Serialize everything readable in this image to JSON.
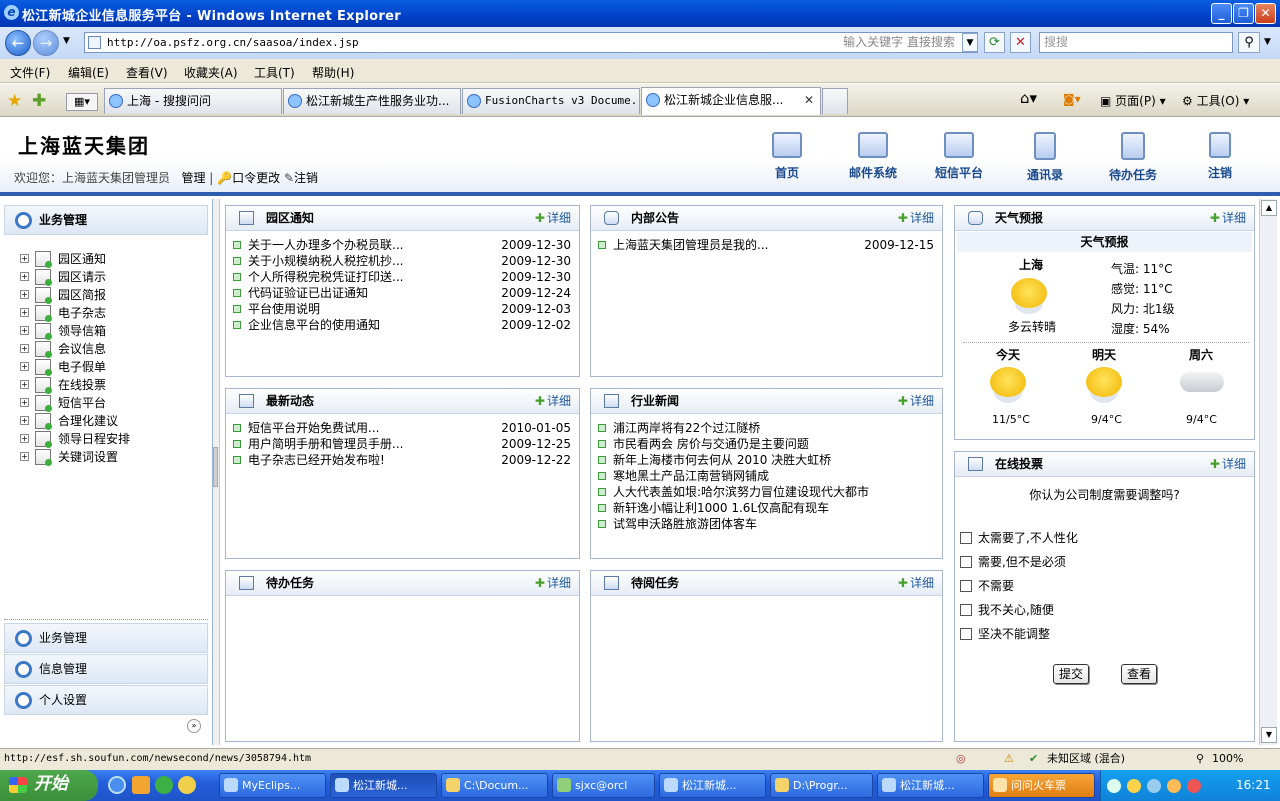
{
  "window": {
    "title": "松江新城企业信息服务平台 - Windows Internet Explorer"
  },
  "browser": {
    "address": "http://oa.psfz.org.cn/saasoa/index.jsp",
    "address_hint": "输入关键字 直接搜索",
    "search_placeholder": "搜搜",
    "menu": [
      "文件(F)",
      "编辑(E)",
      "查看(V)",
      "收藏夹(A)",
      "工具(T)",
      "帮助(H)"
    ],
    "tabs": [
      "上海 - 搜搜问问",
      "松江新城生产性服务业功...",
      "FusionCharts v3 Docume...",
      "松江新城企业信息服..."
    ],
    "page_menu": "页面(P)",
    "tools_menu": "工具(O)",
    "status_url": "http://esf.sh.soufun.com/newsecond/news/3058794.htm",
    "zone": "未知区域 (混合)",
    "zoom": "100%"
  },
  "app": {
    "logo": "上海蓝天集团",
    "welcome": "欢迎您：上海蓝天集团管理员",
    "admin": "管理",
    "change_pwd": "口令更改",
    "logout_link": "注销",
    "nav": [
      "首页",
      "邮件系统",
      "短信平台",
      "通讯录",
      "待办任务",
      "注销"
    ]
  },
  "sidebar": {
    "header": "业务管理",
    "items": [
      "园区通知",
      "园区请示",
      "园区简报",
      "电子杂志",
      "领导信箱",
      "会议信息",
      "电子假单",
      "在线投票",
      "短信平台",
      "合理化建议",
      "领导日程安排",
      "关键词设置"
    ],
    "bottom": [
      "业务管理",
      "信息管理",
      "个人设置"
    ]
  },
  "more_label": "详细",
  "portlets": {
    "notice": {
      "title": "园区通知",
      "rows": [
        {
          "text": "关于一人办理多个办税员联...",
          "date": "2009-12-30"
        },
        {
          "text": "关于小规模纳税人税控机抄...",
          "date": "2009-12-30"
        },
        {
          "text": "个人所得税完税凭证打印送...",
          "date": "2009-12-30"
        },
        {
          "text": "代码证验证已出证通知",
          "date": "2009-12-24"
        },
        {
          "text": "平台使用说明",
          "date": "2009-12-03"
        },
        {
          "text": "企业信息平台的使用通知",
          "date": "2009-12-02"
        }
      ]
    },
    "internal": {
      "title": "内部公告",
      "rows": [
        {
          "text": "上海蓝天集团管理员是我的...",
          "date": "2009-12-15"
        }
      ]
    },
    "news": {
      "title": "最新动态",
      "rows": [
        {
          "text": "短信平台开始免费试用...",
          "date": "2010-01-05"
        },
        {
          "text": "用户简明手册和管理员手册...",
          "date": "2009-12-25"
        },
        {
          "text": "电子杂志已经开始发布啦!",
          "date": "2009-12-22"
        }
      ]
    },
    "industry": {
      "title": "行业新闻",
      "rows": [
        "浦江两岸将有22个过江隧桥",
        "市民看两会 房价与交通仍是主要问题",
        "新年上海楼市何去何从 2010 决胜大虹桥",
        "寒地黑土产品江南营销网铺成",
        "人大代表盖如垠:哈尔滨努力冒位建设现代大都市",
        "新轩逸小幅让利1000 1.6L仅高配有现车",
        "试驾申沃路胜旅游团体客车"
      ]
    },
    "todo": {
      "title": "待办任务"
    },
    "toread": {
      "title": "待阅任务"
    },
    "weather": {
      "title": "天气预报",
      "subtitle": "天气预报",
      "city": "上海",
      "desc": "多云转晴",
      "temp": "气温: 11°C",
      "feel": "感觉: 11°C",
      "wind": "风力: 北1级",
      "humidity": "湿度: 54%",
      "days": [
        {
          "label": "今天",
          "temp": "11/5°C"
        },
        {
          "label": "明天",
          "temp": "9/4°C"
        },
        {
          "label": "周六",
          "temp": "9/4°C"
        }
      ]
    },
    "vote": {
      "title": "在线投票",
      "question": "你认为公司制度需要调整吗?",
      "options": [
        "太需要了,不人性化",
        "需要,但不是必须",
        "不需要",
        "我不关心,随便",
        "坚决不能调整"
      ],
      "submit": "提交",
      "view": "查看"
    }
  },
  "taskbar": {
    "start": "开始",
    "items": [
      "MyEclips...",
      "松江新城...",
      "C:\\Docum...",
      "sjxc@orcl",
      "松江新城...",
      "D:\\Progr...",
      "松江新城...",
      "问问火车票"
    ],
    "clock": "16:21"
  }
}
